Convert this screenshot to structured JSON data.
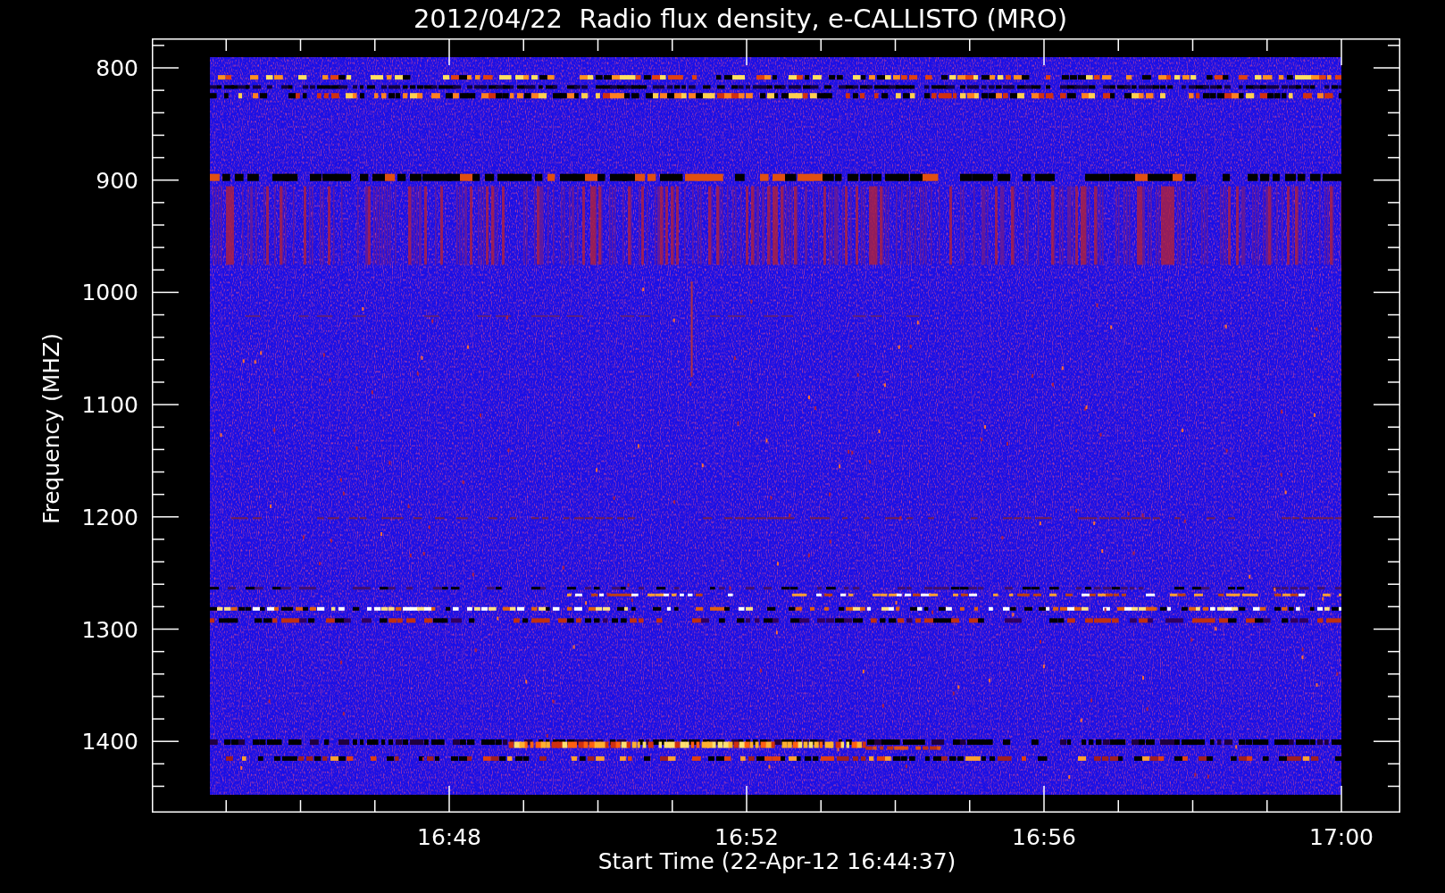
{
  "title": "2012/04/22  Radio flux density, e-CALLISTO (MRO)",
  "y_axis": {
    "label": "Frequency (MHZ)",
    "ticks": [
      "800",
      "900",
      "1000",
      "1100",
      "1200",
      "1300",
      "1400"
    ]
  },
  "x_axis": {
    "label": "Start Time (22-Apr-12 16:44:37)",
    "ticks": [
      "16:48",
      "16:52",
      "16:56",
      "17:00"
    ]
  }
}
